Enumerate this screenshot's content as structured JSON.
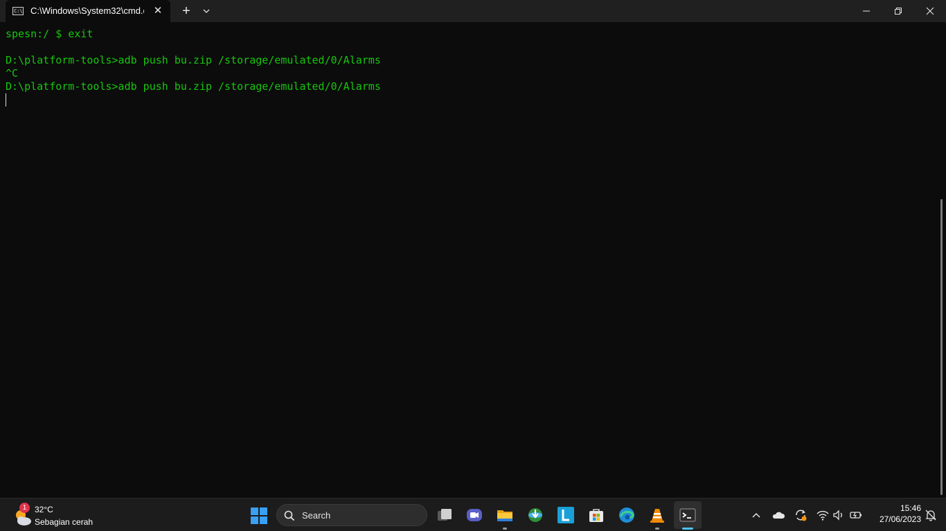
{
  "window": {
    "tab_title": "C:\\Windows\\System32\\cmd.e",
    "tab_close": "✕",
    "new_tab": "+"
  },
  "terminal": {
    "lines": [
      "spesn:/ $ exit",
      "",
      "D:\\platform-tools>adb push bu.zip /storage/emulated/0/Alarms",
      "^C",
      "D:\\platform-tools>adb push bu.zip /storage/emulated/0/Alarms"
    ],
    "text_color": "#16c60c",
    "background": "#0c0c0c"
  },
  "taskbar": {
    "weather": {
      "badge": "1",
      "temperature": "32°C",
      "description": "Sebagian cerah"
    },
    "search": {
      "label": "Search"
    },
    "apps": [
      {
        "name": "Task View",
        "icon": "task-view-icon"
      },
      {
        "name": "Chat",
        "icon": "chat-icon"
      },
      {
        "name": "File Explorer",
        "icon": "folder-icon",
        "running": true
      },
      {
        "name": "Internet Download Manager",
        "icon": "idm-icon"
      },
      {
        "name": "L",
        "icon": "l-app-icon",
        "label": "L"
      },
      {
        "name": "Microsoft Store",
        "icon": "store-icon"
      },
      {
        "name": "Microsoft Edge",
        "icon": "edge-icon"
      },
      {
        "name": "VLC",
        "icon": "vlc-icon",
        "running": true
      },
      {
        "name": "Terminal",
        "icon": "terminal-icon",
        "active": true
      }
    ],
    "tray": {
      "clock_time": "15:46",
      "clock_date": "27/06/2023"
    },
    "accent": "#4cc2ff"
  }
}
